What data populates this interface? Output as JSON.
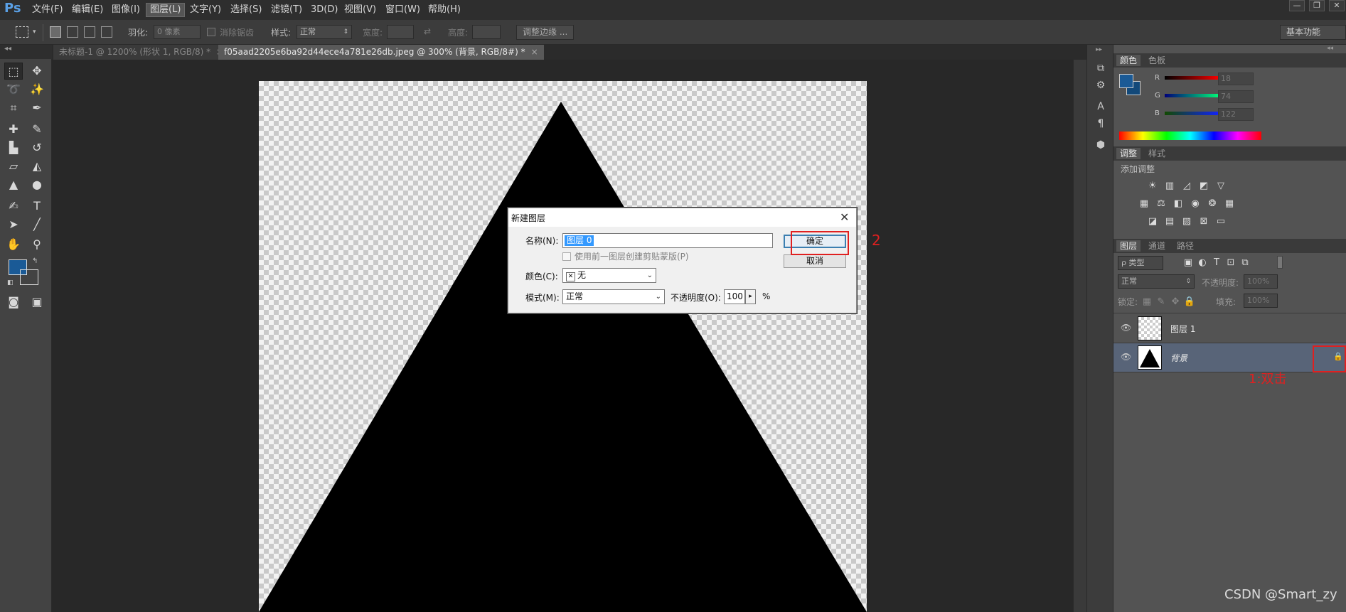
{
  "app": {
    "logo": "Ps"
  },
  "menubar": {
    "items": [
      "文件(F)",
      "编辑(E)",
      "图像(I)",
      "图层(L)",
      "文字(Y)",
      "选择(S)",
      "滤镜(T)",
      "3D(D)",
      "视图(V)",
      "窗口(W)",
      "帮助(H)"
    ],
    "active_index": 3,
    "window_buttons": [
      "—",
      "❐",
      "✕"
    ]
  },
  "options": {
    "feather_label": "羽化:",
    "feather_value": "0 像素",
    "antialias_label": "消除锯齿",
    "style_label": "样式:",
    "style_value": "正常",
    "width_label": "宽度:",
    "height_label": "高度:",
    "refine_button": "调整边缘 ...",
    "workspace": "基本功能"
  },
  "tabs": [
    {
      "label": "未标题-1 @ 1200% (形状 1, RGB/8) *",
      "active": false
    },
    {
      "label": "f05aad2205e6ba92d44ece4a781e26db.jpeg @ 300% (背景, RGB/8#) *",
      "active": true
    }
  ],
  "colors": {
    "foreground": "#1a5a96",
    "background": "#12497a",
    "accent_red": "#e02020",
    "dialog_select": "#3399ff"
  },
  "dialog": {
    "title": "新建图层",
    "name_label": "名称(N):",
    "name_value": "图层 0",
    "clip_label": "使用前一图层创建剪贴蒙版(P)",
    "color_label": "颜色(C):",
    "color_icon": "✕",
    "color_value": "无",
    "mode_label": "模式(M):",
    "mode_value": "正常",
    "opacity_label": "不透明度(O):",
    "opacity_value": "100",
    "opacity_unit": "%",
    "ok_button": "确定",
    "cancel_button": "取消"
  },
  "annotations": {
    "step2": "2",
    "step1": "1:双击"
  },
  "panels": {
    "color_tabs": [
      "颜色",
      "色板"
    ],
    "rgb": [
      {
        "label": "R",
        "value": "18"
      },
      {
        "label": "G",
        "value": "74"
      },
      {
        "label": "B",
        "value": "122"
      }
    ],
    "adjust_tabs": [
      "调整",
      "样式"
    ],
    "adjust_hint": "添加调整",
    "layers_tabs": [
      "图层",
      "通道",
      "路径"
    ],
    "filter_kind": "ρ 类型",
    "blend_mode": "正常",
    "opacity_label": "不透明度:",
    "opacity_value": "100%",
    "lock_label": "锁定:",
    "fill_label": "填充:",
    "fill_value": "100%",
    "layers": [
      {
        "name": "图层 1",
        "kind": "transparent"
      },
      {
        "name": "背景",
        "kind": "triangle",
        "locked": true
      }
    ]
  },
  "watermark": "CSDN @Smart_zy"
}
